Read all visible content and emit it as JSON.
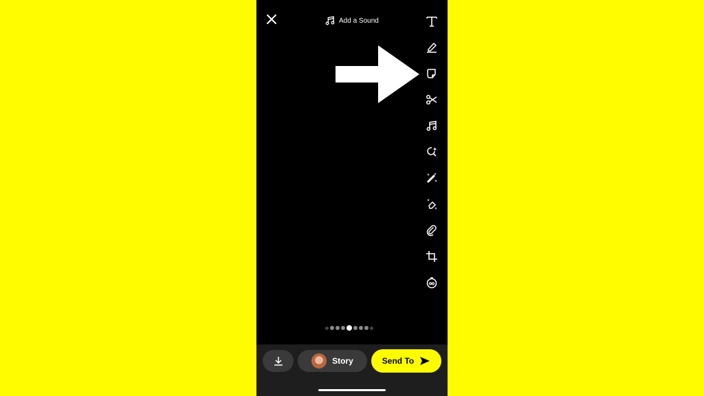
{
  "header": {
    "close_icon": "close-icon",
    "sound_label": "Add a Sound",
    "sound_icon": "music-note-icon"
  },
  "toolbar": {
    "tools": [
      {
        "name": "text",
        "icon": "text-icon"
      },
      {
        "name": "draw",
        "icon": "pencil-icon"
      },
      {
        "name": "sticker",
        "icon": "sticker-icon"
      },
      {
        "name": "scissors",
        "icon": "scissors-icon"
      },
      {
        "name": "music",
        "icon": "music-note-icon"
      },
      {
        "name": "lens-search",
        "icon": "lens-search-icon"
      },
      {
        "name": "magic-wand",
        "icon": "magic-wand-icon"
      },
      {
        "name": "magic-eraser",
        "icon": "eraser-icon"
      },
      {
        "name": "attachment",
        "icon": "paperclip-icon"
      },
      {
        "name": "crop",
        "icon": "crop-icon"
      },
      {
        "name": "timer",
        "icon": "timer-icon"
      }
    ]
  },
  "annotation": {
    "arrow": "pointing-arrow",
    "points_to": "sticker"
  },
  "pager": {
    "count": 9,
    "active_index": 4
  },
  "bottom": {
    "save_icon": "download-icon",
    "story_label": "Story",
    "send_label": "Send To",
    "send_icon": "send-arrow-icon"
  },
  "colors": {
    "brand": "#FFFC00",
    "background": "#000000",
    "bar": "#1e1e1e",
    "button": "#3a3a3a"
  }
}
